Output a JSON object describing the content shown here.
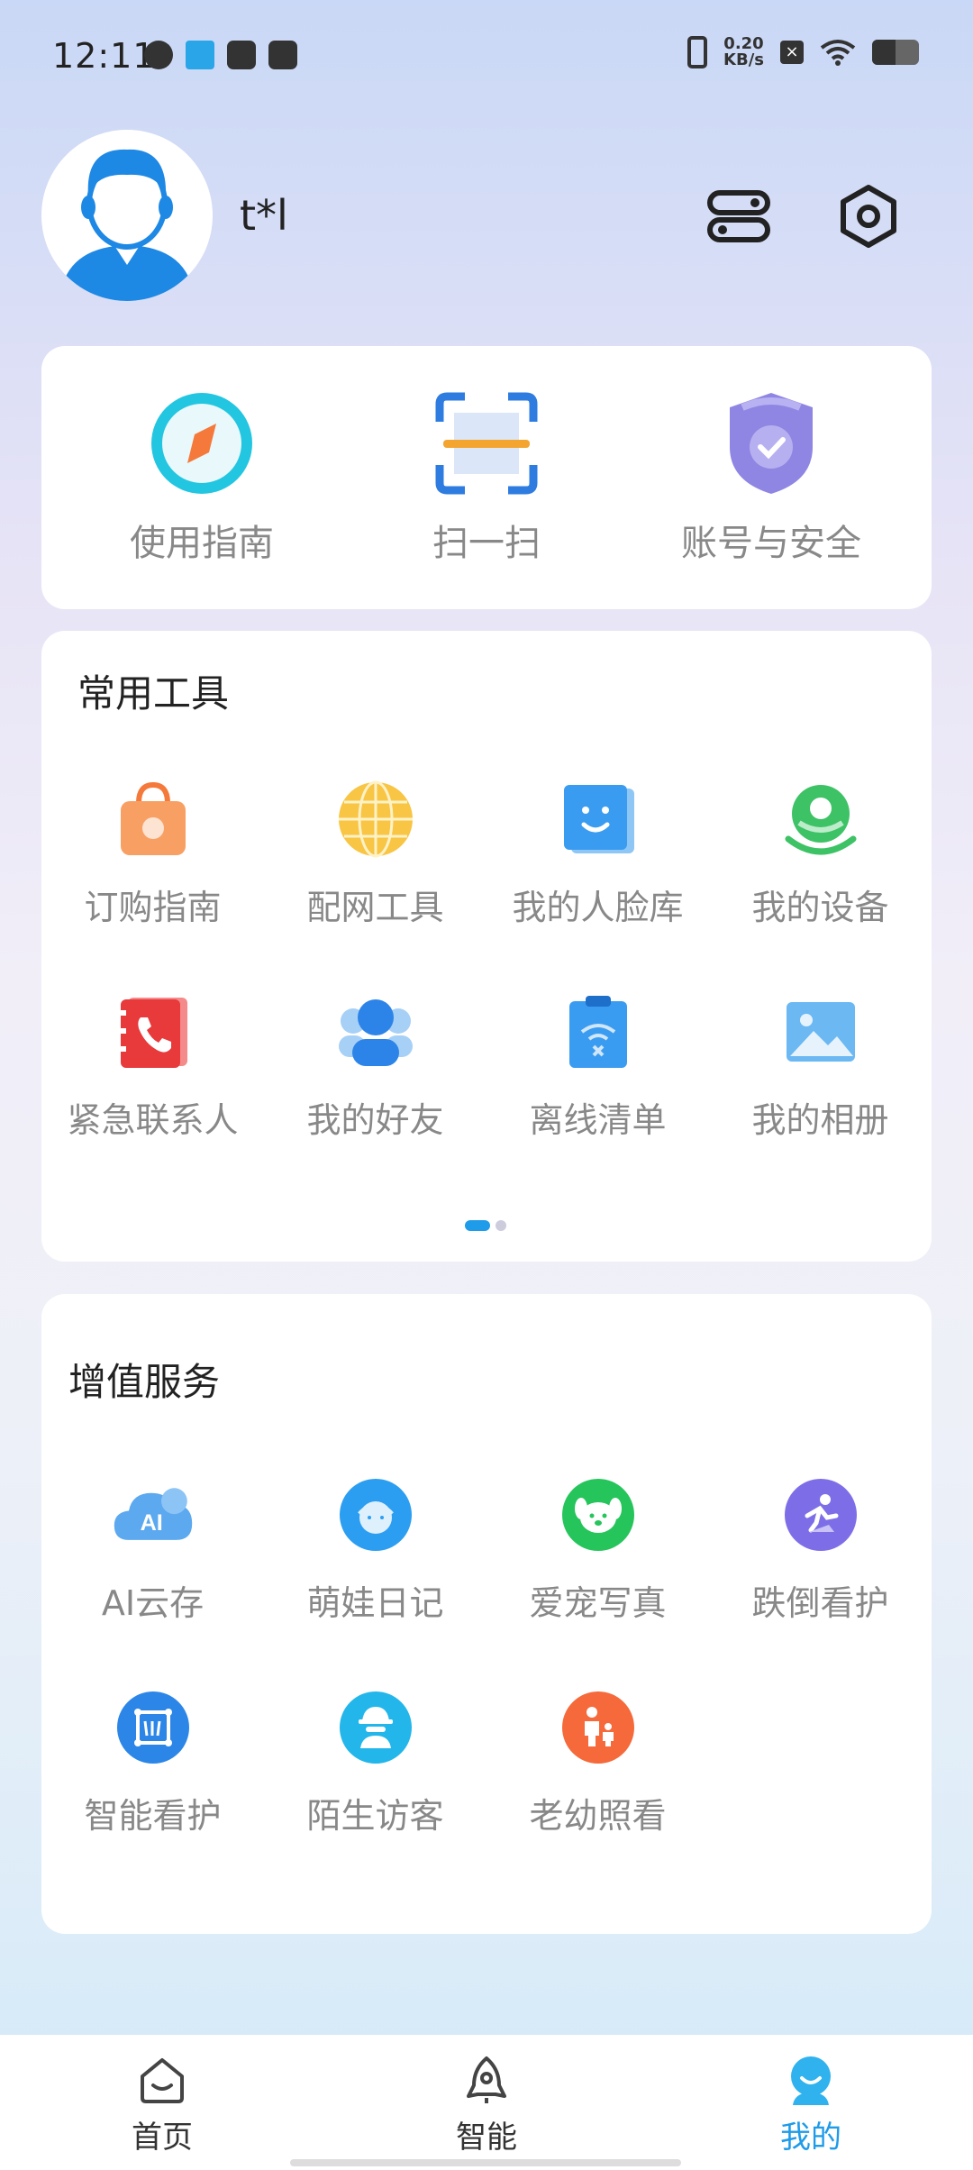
{
  "status": {
    "time": "12:11",
    "speed_top": "0.20",
    "speed_unit": "KB/s"
  },
  "profile": {
    "username": "t*l"
  },
  "quick": [
    {
      "label": "使用指南",
      "icon": "compass-icon"
    },
    {
      "label": "扫一扫",
      "icon": "scan-icon"
    },
    {
      "label": "账号与安全",
      "icon": "shield-icon"
    }
  ],
  "tools": {
    "title": "常用工具",
    "items": [
      {
        "label": "订购指南",
        "icon": "shopping-bag-icon"
      },
      {
        "label": "配网工具",
        "icon": "globe-icon"
      },
      {
        "label": "我的人脸库",
        "icon": "face-icon"
      },
      {
        "label": "我的设备",
        "icon": "camera-device-icon"
      },
      {
        "label": "紧急联系人",
        "icon": "phone-book-icon"
      },
      {
        "label": "我的好友",
        "icon": "friends-icon"
      },
      {
        "label": "离线清单",
        "icon": "offline-list-icon"
      },
      {
        "label": "我的相册",
        "icon": "album-icon"
      }
    ],
    "page_index": 1,
    "page_count": 2
  },
  "services": {
    "title": "增值服务",
    "items": [
      {
        "label": "AI云存",
        "icon": "ai-cloud-icon",
        "badge": "AI"
      },
      {
        "label": "萌娃日记",
        "icon": "baby-icon"
      },
      {
        "label": "爱宠写真",
        "icon": "pet-icon"
      },
      {
        "label": "跌倒看护",
        "icon": "fall-icon"
      },
      {
        "label": "智能看护",
        "icon": "smart-care-icon"
      },
      {
        "label": "陌生访客",
        "icon": "stranger-icon"
      },
      {
        "label": "老幼照看",
        "icon": "elder-child-icon"
      }
    ]
  },
  "nav": [
    {
      "label": "首页",
      "icon": "home-icon"
    },
    {
      "label": "智能",
      "icon": "rocket-icon"
    },
    {
      "label": "我的",
      "icon": "profile-icon",
      "active": true
    }
  ],
  "colors": {
    "accent": "#1e9be9"
  }
}
